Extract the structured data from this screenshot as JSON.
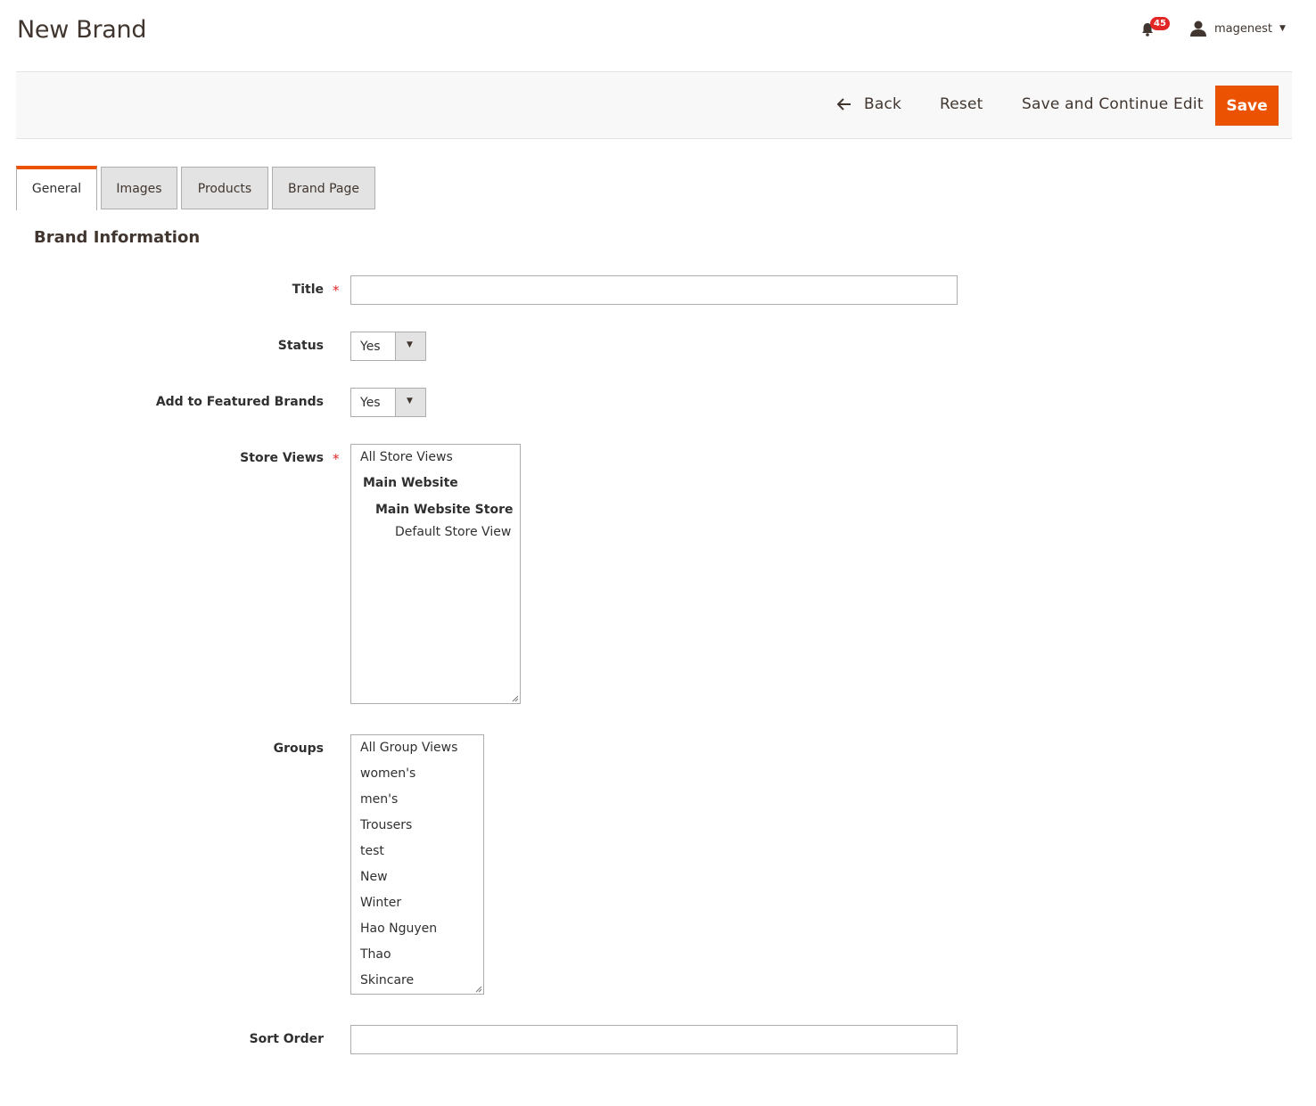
{
  "page": {
    "title": "New Brand"
  },
  "header": {
    "notification_count": "45",
    "username": "magenest"
  },
  "actions": {
    "back": "Back",
    "reset": "Reset",
    "save_continue": "Save and Continue Edit",
    "save": "Save"
  },
  "tabs": [
    {
      "label": "General",
      "active": true
    },
    {
      "label": "Images",
      "active": false
    },
    {
      "label": "Products",
      "active": false
    },
    {
      "label": "Brand Page",
      "active": false
    }
  ],
  "section": {
    "title": "Brand Information"
  },
  "form": {
    "title": {
      "label": "Title",
      "required": "*",
      "value": ""
    },
    "status": {
      "label": "Status",
      "value": "Yes"
    },
    "featured": {
      "label": "Add to Featured Brands",
      "value": "Yes"
    },
    "store_views": {
      "label": "Store Views",
      "required": "*",
      "options": [
        "All Store Views",
        "Main Website",
        "Main Website Store",
        "Default Store View"
      ]
    },
    "groups": {
      "label": "Groups",
      "options": [
        "All Group Views",
        "women's",
        "men's",
        "Trousers",
        "test",
        "New",
        "Winter",
        "Hao Nguyen",
        "Thao",
        "Skincare"
      ]
    },
    "sort_order": {
      "label": "Sort Order",
      "value": ""
    }
  },
  "colors": {
    "accent": "#eb5202",
    "badge": "#e22626",
    "required": "#e22626"
  },
  "icons": {
    "notifications": "bell-icon",
    "user": "user-icon",
    "back": "arrow-left-icon",
    "dropdown": "caret-down-icon"
  }
}
